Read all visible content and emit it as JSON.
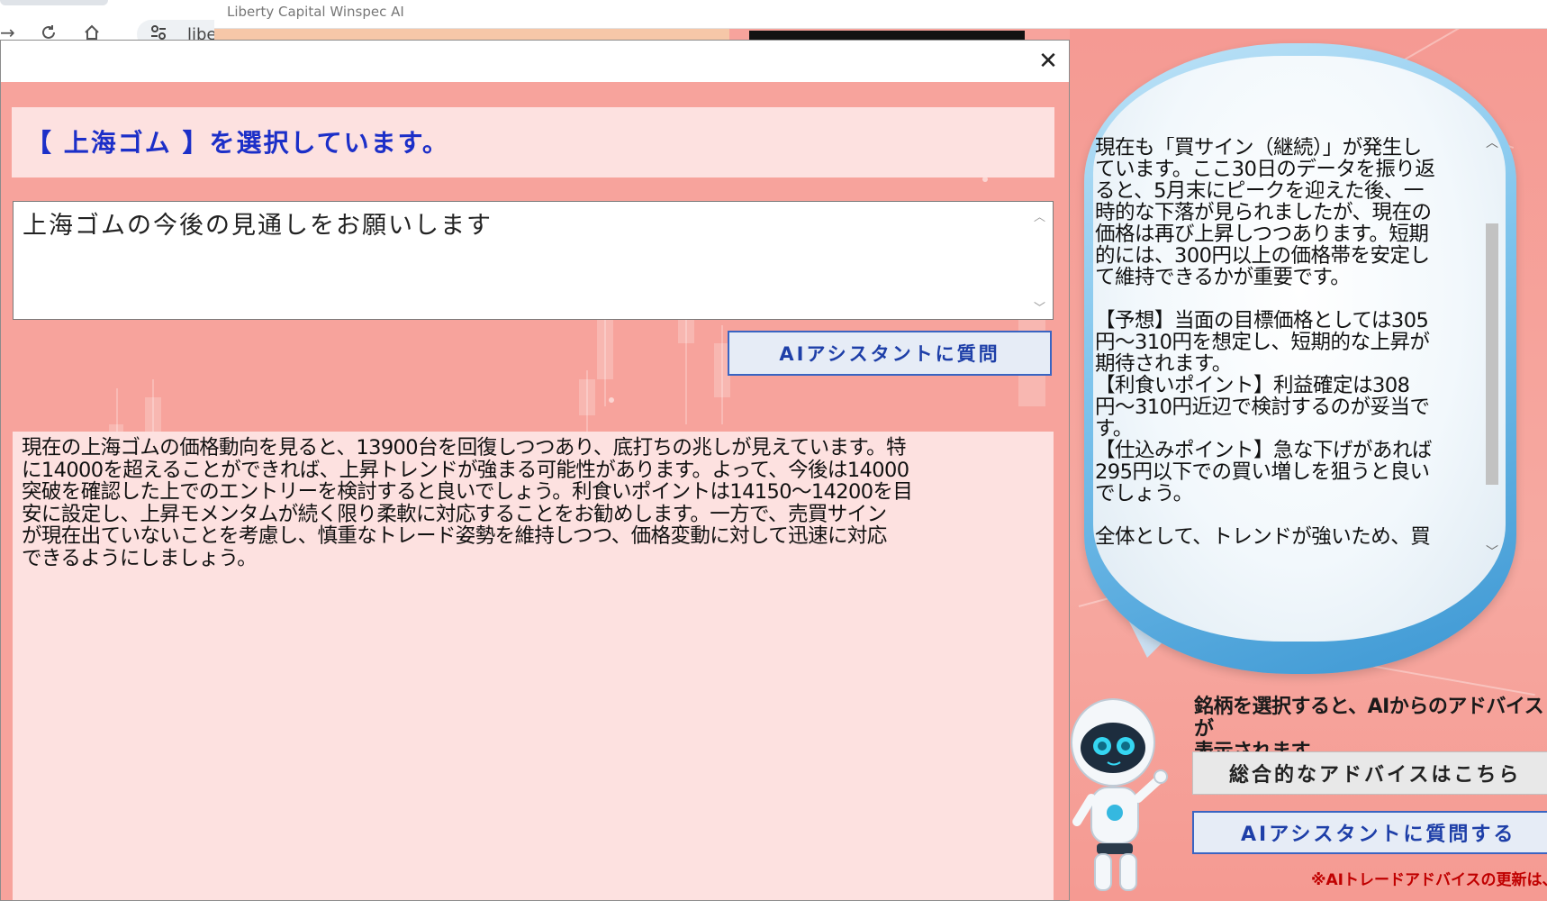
{
  "browser": {
    "address_text": "libe"
  },
  "app": {
    "title": "Liberty Capital Winspec AI"
  },
  "dialog": {
    "selection_text": "【 上海ゴム 】を選択しています。",
    "question_value": "上海ゴムの今後の見通しをお願いします",
    "ask_button_label": "AIアシスタントに質問",
    "answer_text": "現在の上海ゴムの価格動向を見ると、13900台を回復しつつあり、底打ちの兆しが見えています。特\nに14000を超えることができれば、上昇トレンドが強まる可能性があります。よって、今後は14000\n突破を確認した上でのエントリーを検討すると良いでしょう。利食いポイントは14150～14200を目\n安に設定し、上昇モメンタムが続く限り柔軟に対応することをお勧めします。一方で、売買サイン\nが現在出ていないことを考慮し、慎重なトレード姿勢を維持しつつ、価格変動に対して迅速に対応\nできるようにしましょう。"
  },
  "bubble": {
    "text": "現在も「買サイン（継続）」が発生し\nています。ここ30日のデータを振り返\nると、5月末にピークを迎えた後、一\n時的な下落が見られましたが、現在の\n価格は再び上昇しつつあります。短期\n的には、300円以上の価格帯を安定し\nて維持できるかが重要です。\n\n【予想】当面の目標価格としては305\n円～310円を想定し、短期的な上昇が\n期待されます。\n【利食いポイント】利益確定は308\n円～310円近辺で検討するのが妥当で\nす。\n【仕込みポイント】急な下げがあれば\n295円以下での買い増しを狙うと良い\nでしょう。\n\n全体として、トレンドが強いため、買"
  },
  "assistant_panel": {
    "advice_message": "銘柄を選択すると、AIからのアドバイスが\n表示されます。",
    "general_advice_button": "総合的なアドバイスはこちら",
    "ask_assistant_button": "AIアシスタントに質問する",
    "update_note": "※AIトレードアドバイスの更新は、"
  },
  "icons": {
    "back": "back-arrow-icon",
    "reload": "reload-icon",
    "home": "home-icon",
    "site_info": "site-info-icon",
    "close": "close-icon"
  },
  "colors": {
    "background_pink": "#f7a39c",
    "panel_pink": "#fde1e0",
    "accent_blue": "#1c2fc8",
    "button_border": "#3a64c2",
    "note_red": "#c00000"
  }
}
